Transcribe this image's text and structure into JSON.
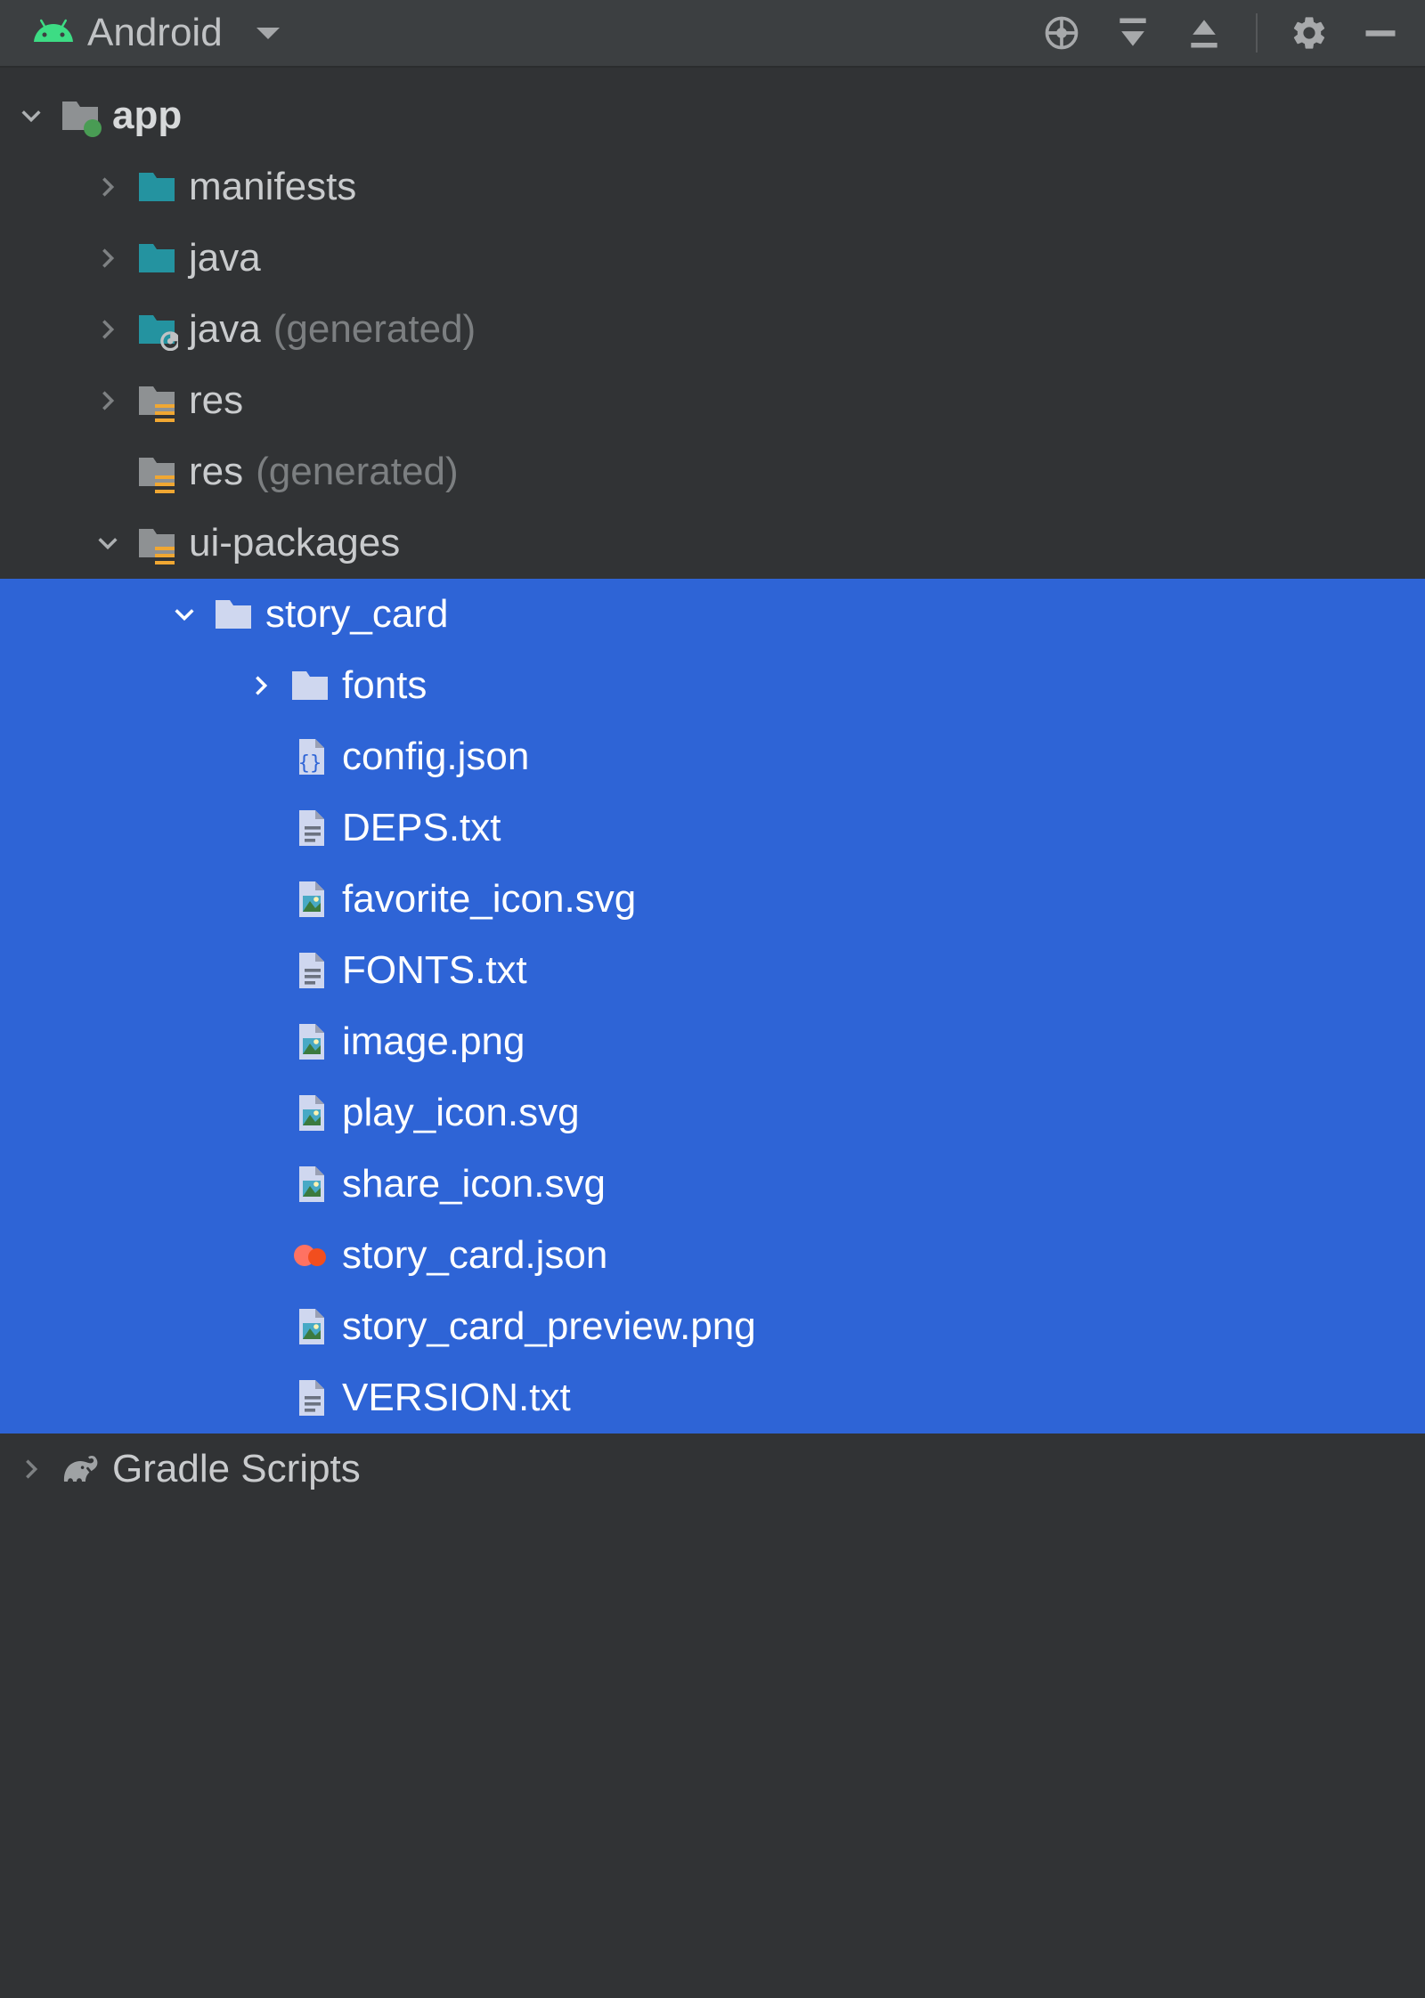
{
  "toolbar": {
    "view_label": "Android"
  },
  "tree": [
    {
      "depth": 0,
      "chev": "down",
      "icon": "module",
      "label": "app",
      "bold": true,
      "selected": false
    },
    {
      "depth": 1,
      "chev": "right",
      "icon": "folder-teal",
      "label": "manifests",
      "bold": false,
      "selected": false
    },
    {
      "depth": 1,
      "chev": "right",
      "icon": "folder-teal",
      "label": "java",
      "bold": false,
      "selected": false
    },
    {
      "depth": 1,
      "chev": "right",
      "icon": "folder-gen",
      "label": "java",
      "suffix": "(generated)",
      "bold": false,
      "selected": false
    },
    {
      "depth": 1,
      "chev": "right",
      "icon": "folder-res",
      "label": "res",
      "bold": false,
      "selected": false
    },
    {
      "depth": 1,
      "chev": "",
      "icon": "folder-res",
      "label": "res",
      "suffix": "(generated)",
      "bold": false,
      "selected": false
    },
    {
      "depth": 1,
      "chev": "down",
      "icon": "folder-res",
      "label": "ui-packages",
      "bold": false,
      "selected": false
    },
    {
      "depth": 2,
      "chev": "down",
      "icon": "folder-sel",
      "label": "story_card",
      "bold": false,
      "selected": true
    },
    {
      "depth": 3,
      "chev": "right",
      "icon": "folder-sel",
      "label": "fonts",
      "bold": false,
      "selected": true
    },
    {
      "depth": 3,
      "chev": "",
      "icon": "json",
      "label": "config.json",
      "bold": false,
      "selected": true
    },
    {
      "depth": 3,
      "chev": "",
      "icon": "txt",
      "label": "DEPS.txt",
      "bold": false,
      "selected": true
    },
    {
      "depth": 3,
      "chev": "",
      "icon": "img",
      "label": "favorite_icon.svg",
      "bold": false,
      "selected": true
    },
    {
      "depth": 3,
      "chev": "",
      "icon": "txt",
      "label": "FONTS.txt",
      "bold": false,
      "selected": true
    },
    {
      "depth": 3,
      "chev": "",
      "icon": "img",
      "label": "image.png",
      "bold": false,
      "selected": true
    },
    {
      "depth": 3,
      "chev": "",
      "icon": "img",
      "label": "play_icon.svg",
      "bold": false,
      "selected": true
    },
    {
      "depth": 3,
      "chev": "",
      "icon": "img",
      "label": "share_icon.svg",
      "bold": false,
      "selected": true
    },
    {
      "depth": 3,
      "chev": "",
      "icon": "figma",
      "label": "story_card.json",
      "bold": false,
      "selected": true
    },
    {
      "depth": 3,
      "chev": "",
      "icon": "img",
      "label": "story_card_preview.png",
      "bold": false,
      "selected": true
    },
    {
      "depth": 3,
      "chev": "",
      "icon": "txt",
      "label": "VERSION.txt",
      "bold": false,
      "selected": true
    },
    {
      "depth": 0,
      "chev": "right",
      "icon": "gradle",
      "label": "Gradle Scripts",
      "bold": false,
      "selected": false
    }
  ]
}
